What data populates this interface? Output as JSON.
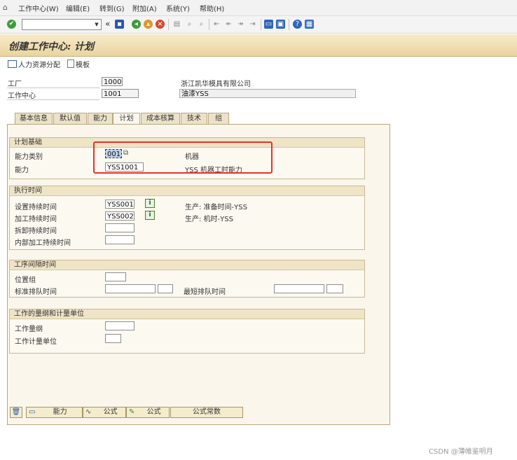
{
  "menubar": {
    "items": [
      "工作中心(W)",
      "编辑(E)",
      "转到(G)",
      "附加(A)",
      "系统(Y)",
      "帮助(H)"
    ]
  },
  "toolbar": {
    "command_value": "",
    "back_glyph": "«"
  },
  "title": "创建工作中心: 计划",
  "app_toolbar": {
    "hr_button": "人力资源分配",
    "template_button": "模板"
  },
  "header": {
    "plant_label": "工厂",
    "plant_value": "1000",
    "plant_desc": "浙江凯华模具有限公司",
    "workcenter_label": "工作中心",
    "workcenter_value": "1001",
    "workcenter_desc": "油漆YSS"
  },
  "tabs": [
    "基本信息",
    "默认值",
    "能力",
    "计划",
    "成本核算",
    "技术",
    "组"
  ],
  "active_tab": "计划",
  "groups": {
    "planning_basis": {
      "title": "计划基础",
      "capacity_category_label": "能力类别",
      "capacity_category_value": "001",
      "capacity_category_desc": "机器",
      "capacity_label": "能力",
      "capacity_value": "YSS1001",
      "capacity_desc": "YSS 机器工时能力"
    },
    "execution_time": {
      "title": "执行时间",
      "setup_label": "设置持续时间",
      "setup_value": "YSS001",
      "setup_desc": "生产: 准备时间-YSS",
      "processing_label": "加工持续时间",
      "processing_value": "YSS002",
      "processing_desc": "生产: 机时-YSS",
      "teardown_label": "拆卸持续时间",
      "internal_label": "内部加工持续时间"
    },
    "interop_time": {
      "title": "工序间隔时间",
      "location_group_label": "位置组",
      "std_queue_label": "标准排队时间",
      "min_queue_label": "最短排队时间"
    },
    "work_quantity": {
      "title": "工作的量纲和计量单位",
      "dimension_label": "工作量纲",
      "unit_label": "工作计量单位"
    }
  },
  "bottom_buttons": {
    "capacity": "能力",
    "formula1": "公式",
    "formula2": "公式",
    "formula_const": "公式常数"
  },
  "watermark": "CSDN @薄帷鉴明月",
  "colors": {
    "highlight": "#e8302e",
    "title_bg": "#ead4a0",
    "panel_bg": "#faf6ec"
  }
}
